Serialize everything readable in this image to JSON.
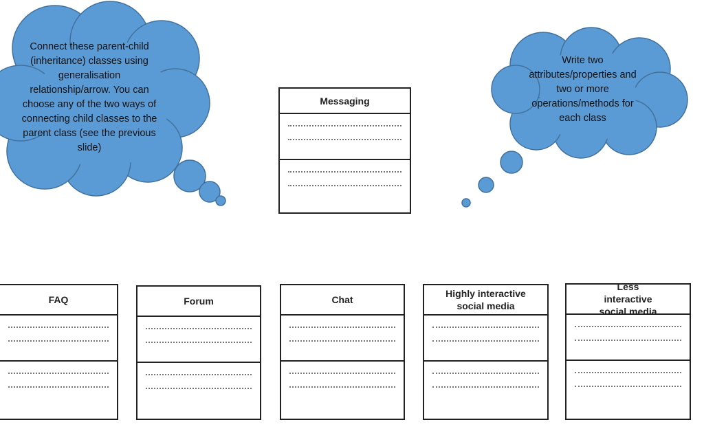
{
  "instructions": {
    "left_cloud": "Connect these parent-child (inheritance) classes using generalisation relationship/arrow. You can choose any of the two ways of connecting child classes to the parent class (see the previous slide)",
    "right_cloud": "Write two attributes/properties and two or more operations/methods for each class"
  },
  "parent_class": {
    "name": "Messaging"
  },
  "child_classes": [
    {
      "name": "FAQ"
    },
    {
      "name": "Forum"
    },
    {
      "name": "Chat"
    },
    {
      "name": "Highly interactive social media"
    },
    {
      "name": "Less interactive social media"
    }
  ],
  "colors": {
    "cloud_fill": "#5b9bd5",
    "cloud_border": "#41719c",
    "box_border": "#222222"
  }
}
